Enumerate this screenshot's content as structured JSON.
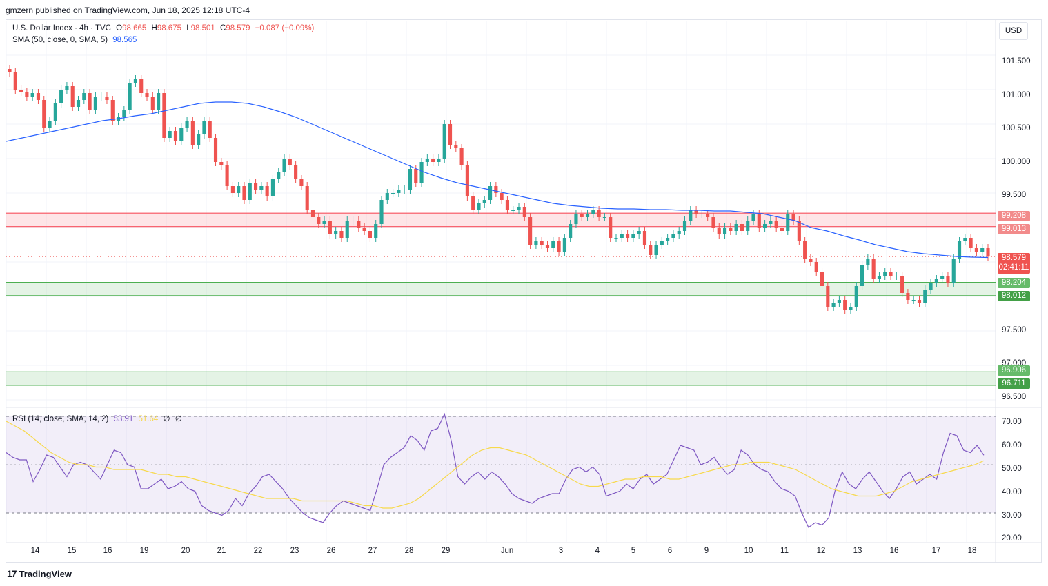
{
  "header": {
    "publisher_line": "gmzern published on TradingView.com, Jun 18, 2025 12:18 UTC-4"
  },
  "legend": {
    "symbol": "U.S. Dollar Index · 4h · TVC",
    "open_label": "O",
    "open": "98.665",
    "high_label": "H",
    "high": "98.675",
    "low_label": "L",
    "low": "98.501",
    "close_label": "C",
    "close": "98.579",
    "change": "−0.087 (−0.09%)",
    "sma_label": "SMA (50, close, 0, SMA, 5)",
    "sma_value": "98.565",
    "rsi_label": "RSI (14, close, SMA, 14, 2)",
    "rsi_value": "53.91",
    "rsi_sma_value": "51.64",
    "rsi_extra1": "∅",
    "rsi_extra2": "∅"
  },
  "currency_button": "USD",
  "price_axis_ticks": [
    "101.500",
    "101.000",
    "100.500",
    "100.000",
    "99.500",
    "97.500",
    "97.000",
    "96.500"
  ],
  "price_labels": {
    "res_top": "99.208",
    "res_bottom": "99.013",
    "current": "98.579",
    "countdown": "02:41:11",
    "sup1_top": "98.204",
    "sup1_bottom": "98.012",
    "sup2_top": "96.906",
    "sup2_bottom": "96.711"
  },
  "rsi_axis_ticks": [
    "70.00",
    "60.00",
    "50.00",
    "40.00",
    "30.00",
    "20.00"
  ],
  "x_axis_ticks": [
    "14",
    "15",
    "16",
    "19",
    "20",
    "21",
    "22",
    "23",
    "26",
    "27",
    "28",
    "29",
    "Jun",
    "3",
    "4",
    "5",
    "6",
    "9",
    "10",
    "11",
    "12",
    "13",
    "16",
    "17",
    "18"
  ],
  "footer_brand": "TradingView",
  "colors": {
    "up": "#26a69a",
    "down": "#ef5350",
    "sma": "#2962ff",
    "rsi": "#7e57c2",
    "rsi_ma": "#f7d94c",
    "resistance_zone": "#f7525f",
    "support_zone": "#4caf50"
  },
  "chart_data": {
    "type": "candlestick",
    "timeframe": "4h",
    "price_zones": [
      {
        "kind": "resistance",
        "top": 99.208,
        "bottom": 99.013
      },
      {
        "kind": "support",
        "top": 98.204,
        "bottom": 98.012
      },
      {
        "kind": "support",
        "top": 96.906,
        "bottom": 96.711
      }
    ],
    "price_range": [
      96.4,
      101.9
    ],
    "rsi_range": [
      18,
      72
    ],
    "rsi_levels": [
      70,
      30
    ],
    "candles_close": [
      101.25,
      101.0,
      100.97,
      100.9,
      100.95,
      100.85,
      100.45,
      100.55,
      100.8,
      101.0,
      101.05,
      100.75,
      100.85,
      100.95,
      100.7,
      100.9,
      100.9,
      100.85,
      100.55,
      100.6,
      100.7,
      101.1,
      101.15,
      100.95,
      100.9,
      100.7,
      100.95,
      100.3,
      100.4,
      100.25,
      100.45,
      100.55,
      100.2,
      100.35,
      100.55,
      100.3,
      99.95,
      99.9,
      99.6,
      99.5,
      99.6,
      99.4,
      99.65,
      99.55,
      99.6,
      99.45,
      99.7,
      99.8,
      100.0,
      99.9,
      99.7,
      99.6,
      99.25,
      99.15,
      99.05,
      99.1,
      98.9,
      98.95,
      98.85,
      99.1,
      99.1,
      99.0,
      98.95,
      98.85,
      99.05,
      99.4,
      99.5,
      99.5,
      99.55,
      99.55,
      99.85,
      99.65,
      99.95,
      100.0,
      99.95,
      100.0,
      100.5,
      100.2,
      100.15,
      99.9,
      99.45,
      99.25,
      99.35,
      99.4,
      99.6,
      99.5,
      99.4,
      99.25,
      99.25,
      99.3,
      99.15,
      98.75,
      98.8,
      98.75,
      98.7,
      98.8,
      98.65,
      98.85,
      99.05,
      99.2,
      99.15,
      99.2,
      99.25,
      99.15,
      99.15,
      98.85,
      98.85,
      98.9,
      98.85,
      98.9,
      98.95,
      98.75,
      98.6,
      98.75,
      98.8,
      98.85,
      98.9,
      98.95,
      99.1,
      99.25,
      99.2,
      99.2,
      99.15,
      99.0,
      98.9,
      99.0,
      98.95,
      99.05,
      98.95,
      99.1,
      99.2,
      99.0,
      99.05,
      99.1,
      99.0,
      98.95,
      99.2,
      99.1,
      98.8,
      98.55,
      98.5,
      98.35,
      98.15,
      97.85,
      97.9,
      97.95,
      97.8,
      97.85,
      98.15,
      98.45,
      98.55,
      98.25,
      98.3,
      98.35,
      98.3,
      98.3,
      98.05,
      97.95,
      97.95,
      97.9,
      98.1,
      98.2,
      98.25,
      98.3,
      98.2,
      98.55,
      98.8,
      98.85,
      98.7,
      98.65,
      98.7,
      98.579
    ],
    "sma_50": [
      100.25,
      100.3,
      100.35,
      100.4,
      100.45,
      100.5,
      100.55,
      100.58,
      100.62,
      100.65,
      100.7,
      100.75,
      100.8,
      100.82,
      100.82,
      100.8,
      100.75,
      100.68,
      100.6,
      100.5,
      100.4,
      100.3,
      100.2,
      100.1,
      100.0,
      99.9,
      99.8,
      99.72,
      99.65,
      99.6,
      99.55,
      99.5,
      99.45,
      99.4,
      99.35,
      99.32,
      99.3,
      99.28,
      99.27,
      99.27,
      99.26,
      99.26,
      99.25,
      99.25,
      99.24,
      99.24,
      99.22,
      99.2,
      99.15,
      99.1,
      99.0,
      98.95,
      98.88,
      98.82,
      98.75,
      98.7,
      98.65,
      98.62,
      98.6,
      98.58,
      98.57,
      98.565
    ],
    "rsi": [
      55,
      53,
      52,
      52,
      43,
      48,
      54,
      53,
      49,
      45,
      50,
      51,
      50,
      47,
      44,
      50,
      56,
      55,
      50,
      49,
      40,
      40,
      42,
      44,
      40,
      41,
      43,
      40,
      39,
      33,
      31,
      30,
      29,
      31,
      36,
      33,
      38,
      41,
      45,
      46,
      43,
      40,
      36,
      33,
      30,
      28,
      27,
      26,
      30,
      33,
      35,
      34,
      33,
      32,
      31,
      40,
      50,
      53,
      55,
      57,
      62,
      60,
      56,
      64,
      65,
      71,
      60,
      45,
      42,
      45,
      47,
      44,
      47,
      45,
      42,
      38,
      36,
      35,
      34,
      36,
      37,
      38,
      38,
      44,
      48,
      49,
      47,
      49,
      46,
      37,
      38,
      39,
      42,
      40,
      44,
      46,
      42,
      44,
      46,
      52,
      58,
      57,
      56,
      50,
      51,
      53,
      49,
      46,
      48,
      56,
      54,
      50,
      48,
      47,
      43,
      40,
      39,
      37,
      30,
      24,
      26,
      25,
      28,
      40,
      47,
      42,
      40,
      44,
      47,
      43,
      39,
      36,
      40,
      45,
      47,
      42,
      44,
      46,
      44,
      55,
      63,
      62,
      56,
      55,
      58,
      53.91
    ],
    "rsi_ma": [
      68,
      66,
      64,
      61,
      58,
      55,
      53,
      51,
      50,
      50,
      49,
      49,
      48,
      48,
      48,
      48,
      47,
      46,
      46,
      45,
      45,
      44,
      43,
      42,
      41,
      40,
      39,
      38,
      37,
      36,
      36,
      36,
      36,
      35,
      35,
      35,
      35,
      35,
      35,
      34,
      33,
      33,
      32,
      32,
      33,
      34,
      36,
      39,
      42,
      45,
      48,
      51,
      54,
      56,
      57,
      57,
      56,
      55,
      54,
      52,
      50,
      48,
      46,
      44,
      42,
      41,
      41,
      42,
      43,
      44,
      44,
      45,
      45,
      45,
      44,
      44,
      45,
      46,
      47,
      48,
      49,
      50,
      50,
      51,
      51,
      51,
      50,
      49,
      48,
      46,
      44,
      42,
      40,
      39,
      38,
      37,
      37,
      37,
      38,
      39,
      41,
      43,
      44,
      45,
      46,
      47,
      48,
      49,
      50,
      51.64
    ]
  }
}
